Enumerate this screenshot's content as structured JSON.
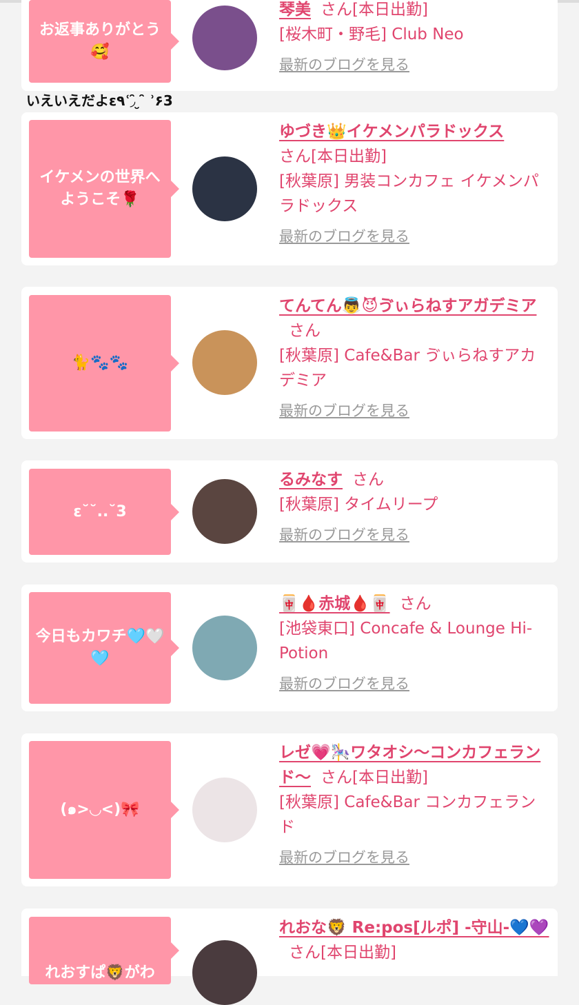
{
  "cards": [
    {
      "message": "お返事ありがとう🥰",
      "name": "琴美",
      "suffix": "さん[本日出勤]",
      "shop": "[桜木町・野毛] Club Neo",
      "blog_link": "最新のブログを見る",
      "avatar_color": "#7a4f8c"
    },
    {
      "message": "イケメンの世界へようこそ🌹",
      "name": "ゆづき👑イケメンパラドックス",
      "suffix": "さん[本日出勤]",
      "shop": "[秋葉原] 男装コンカフェ イケメンパラドックス",
      "blog_link": "最新のブログを見る",
      "avatar_color": "#2b3344"
    },
    {
      "message": "🐈🐾🐾",
      "name": "てんてん👼😈ゔぃらねすアガデミア",
      "suffix": "さん",
      "shop": "[秋葉原] Cafe&Bar ゔぃらねすアカデミア",
      "blog_link": "最新のブログを見る",
      "avatar_color": "#c9935a"
    },
    {
      "message": "ε˘˘..˘3",
      "name": "るみなす",
      "suffix": "さん",
      "shop": "[秋葉原] タイムリープ",
      "blog_link": "最新のブログを見る",
      "avatar_color": "#5a4540"
    },
    {
      "message": "今日もカワチ🩵🤍🩵",
      "name": "🀄🩸赤城🩸🀄",
      "suffix": "さん",
      "shop": "[池袋東口] Concafe & Lounge Hi-Potion",
      "blog_link": "最新のブログを見る",
      "avatar_color": "#7fa9b3"
    },
    {
      "message": "(๑>◡<)🎀",
      "name": "レゼ💗🎠ワタオシ〜コンカフェランド〜",
      "suffix": "さん[本日出勤]",
      "shop": "[秋葉原] Cafe&Bar コンカフェランド",
      "blog_link": "最新のブログを見る",
      "avatar_color": "#ece4e6"
    },
    {
      "message": "れおすぱ🦁がわ",
      "name": "れおな🦁 Re:pos[ルポ] -守山-💙💜",
      "suffix": "さん[本日出勤]",
      "shop": "",
      "blog_link": "",
      "avatar_color": "#4a3b3e"
    }
  ],
  "reply_text": "いえいえだよε٩ʿ◞ ̑̑ ̮ ̑̑ʾ۶3"
}
